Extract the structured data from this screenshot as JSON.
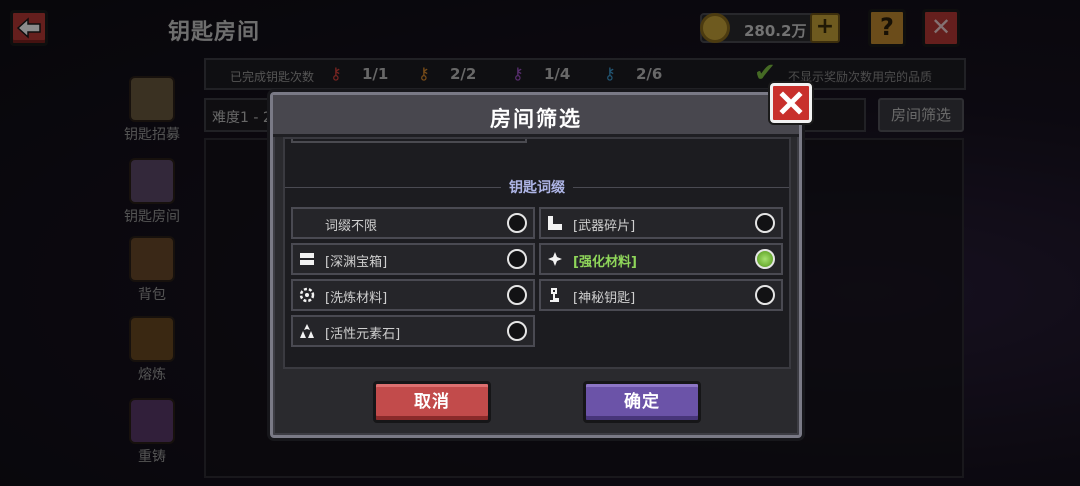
{
  "header": {
    "title": "钥匙房间",
    "coins": "280.2万"
  },
  "stats": {
    "label": "已完成钥匙次数",
    "keys": [
      {
        "value": "1/1",
        "color": "#d9433c"
      },
      {
        "value": "2/2",
        "color": "#d98a2c"
      },
      {
        "value": "1/4",
        "color": "#a053c9"
      },
      {
        "value": "2/6",
        "color": "#3d9bd1"
      }
    ],
    "hide_label": "不显示奖励次数用完的品质"
  },
  "sidebar": {
    "items": [
      {
        "label": "钥匙招募",
        "icon": "key-recruit-icon",
        "color": "#6b5a3e"
      },
      {
        "label": "钥匙房间",
        "icon": "key-room-icon",
        "color": "#5e4a6a"
      },
      {
        "label": "背包",
        "icon": "backpack-icon",
        "color": "#6b4a2a"
      },
      {
        "label": "熔炼",
        "icon": "smelt-icon",
        "color": "#6a4a22"
      },
      {
        "label": "重铸",
        "icon": "recast-icon",
        "color": "#5a3a6a"
      }
    ]
  },
  "toolbar": {
    "difficulty": "难度1 - 2",
    "filter_button": "房间筛选"
  },
  "modal": {
    "title": "房间筛选",
    "section_title": "钥匙词缀",
    "options": [
      {
        "label": "词缀不限",
        "icon": "",
        "selected": false
      },
      {
        "label": "[武器碎片]",
        "icon": "weapon-fragment-icon",
        "selected": false
      },
      {
        "label": "[深渊宝箱]",
        "icon": "abyss-chest-icon",
        "selected": false
      },
      {
        "label": "[强化材料]",
        "icon": "enhance-material-icon",
        "selected": true
      },
      {
        "label": "[洗炼材料]",
        "icon": "refine-material-icon",
        "selected": false
      },
      {
        "label": "[神秘钥匙]",
        "icon": "mystery-key-icon",
        "selected": false
      },
      {
        "label": "[活性元素石]",
        "icon": "element-stone-icon",
        "selected": false
      }
    ],
    "cancel_label": "取消",
    "confirm_label": "确定"
  }
}
